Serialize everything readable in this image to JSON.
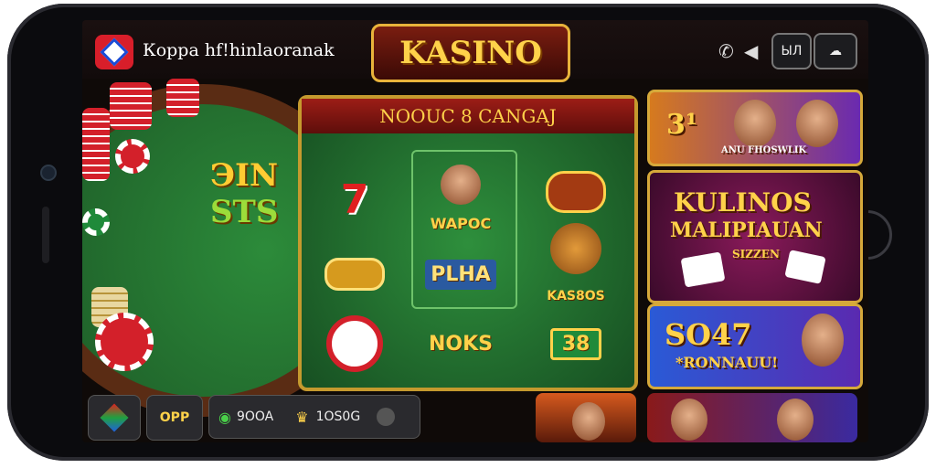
{
  "header": {
    "app_title": "Корра hf!hinlaoranak",
    "logo": "KASINO",
    "sort_box_label": "ЫЛ",
    "back_icon": "back-icon",
    "share_icon": "share-icon",
    "cloud_icon": "cloud-icon"
  },
  "left_promo": {
    "line1": "ЭIN",
    "line2": "STS"
  },
  "board": {
    "title": "NOOUC 8 CANGAJ",
    "cells": [
      "7",
      "WAPOC",
      "",
      "",
      "",
      "KAS8OS",
      "",
      "NOKS",
      "38"
    ],
    "labels": {
      "wapoc": "WAPOC",
      "plha": "PLHA",
      "kasos": "KAS8OS",
      "noks": "NOKS",
      "num": "38"
    }
  },
  "right_cards": [
    {
      "title": "3¹",
      "subtitle": "ANU FHOSWLIK"
    },
    {
      "title": "KULINOS",
      "title2": "MALIPIAUAN",
      "subtitle": "SIZZEN"
    },
    {
      "title": "SO47",
      "subtitle": "*RONNAUU!"
    },
    {
      "title": ""
    }
  ],
  "bottom": {
    "store_label": "",
    "opp_label": "OPP",
    "credits": "9OOA",
    "coins": "1OS0G"
  },
  "colors": {
    "gold": "#ffd24a",
    "felt": "#2e8f3c",
    "red": "#d81e2a"
  }
}
